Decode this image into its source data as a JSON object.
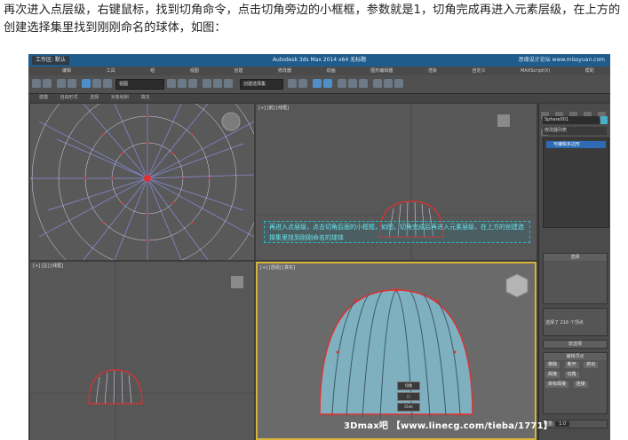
{
  "caption": "再次进入点层级，右键鼠标，找到切角命令，点击切角旁边的小框框，参数就是1，切角完成再进入元素层级，在上方的创建选择集里找到刚刚命名的球体，如图：",
  "app": {
    "workspace_label": "工作区: 默认",
    "window_title": "Autodesk 3ds Max  2014 x64      无标题",
    "watermark_top": "思缘设计论坛 www.missyuan.com"
  },
  "menu": [
    "编辑",
    "工具",
    "组",
    "视图",
    "创建",
    "修改器",
    "动画",
    "图形编辑器",
    "渲染",
    "自定义",
    "MAXScript(X)",
    "帮助"
  ],
  "toolbar": {
    "view_combo": "视图",
    "selection_set_combo": "创建选择集"
  },
  "subbar": [
    "建模",
    "自由形式",
    "选择",
    "对象绘制",
    "填充"
  ],
  "viewports": {
    "top_label": "[+] [顶] [线框]",
    "front_label": "[+] [前] [线框]",
    "left_label": "[+] [左] [线框]",
    "persp_label": "[+] [透视] [真实]"
  },
  "annotation": "再进入点层级，点击切角后面的小框框，如图，切角完成后再进入元素层级，在上方的创建选择集里找到刚刚命名的球体",
  "command_panel": {
    "object_name": "Sphere001",
    "modifier_list": "修改器列表",
    "stack_item": "可编辑多边形",
    "selection_header": "选择",
    "soft_selection": "软选择",
    "edit_vertices": "编辑顶点",
    "buttons": [
      "移除",
      "断开",
      "挤出",
      "焊接",
      "切角",
      "目标焊接",
      "连接"
    ],
    "status": "选择了 216 个顶点",
    "weight_label": "权重:",
    "weight_value": "1.0"
  },
  "quad_menu": [
    "切角",
    "□",
    "Chm"
  ],
  "footer_watermark": "3Dmax吧 【www.linecg.com/tieba/1771】",
  "colors": {
    "titlebar": "#1f5c8c",
    "viewport_bg": "#575757",
    "annotation_text": "#66e3ee",
    "active_border": "#d6b43a",
    "stack_highlight": "#2d6cb5"
  }
}
